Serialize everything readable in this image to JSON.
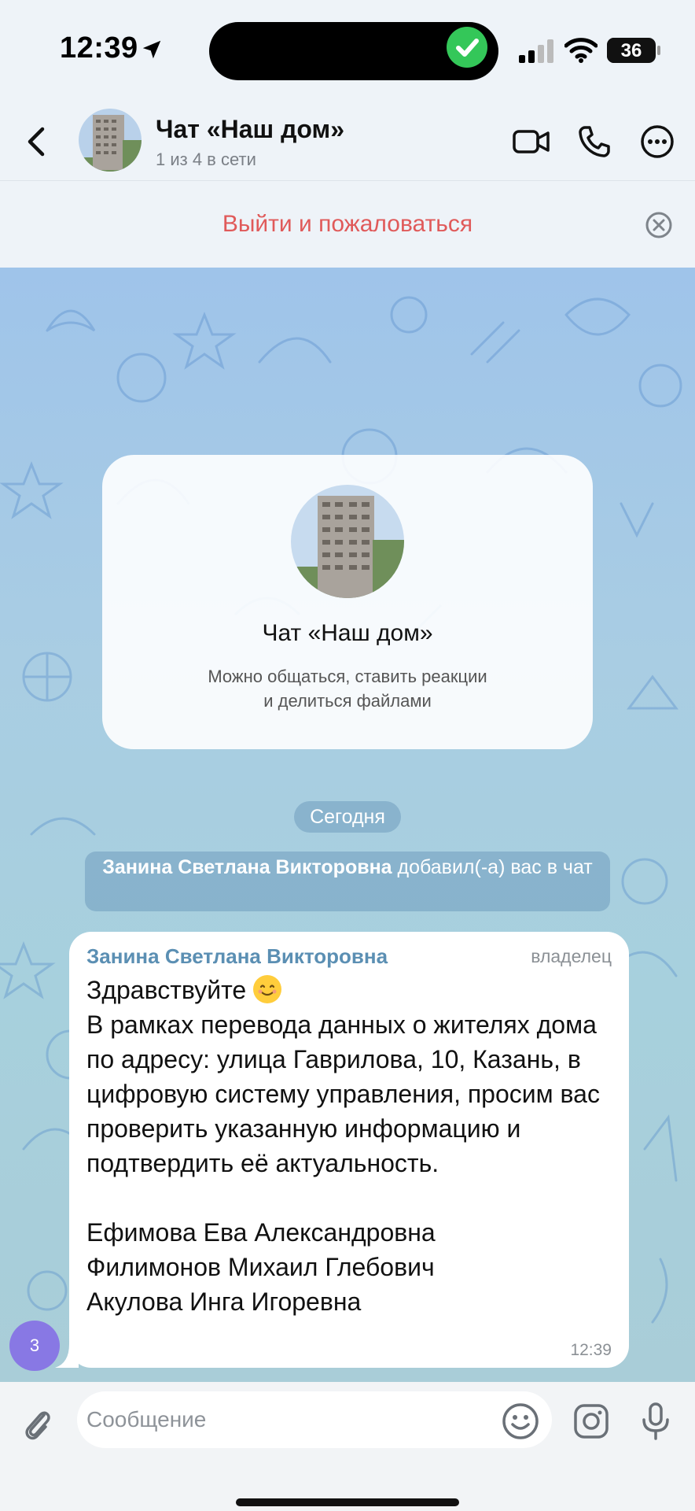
{
  "status_bar": {
    "time": "12:39",
    "battery": "36",
    "battery_level_percent": 36
  },
  "header": {
    "title": "Чат «Наш дом»",
    "subtitle": "1 из 4 в сети"
  },
  "report_bar": {
    "label": "Выйти и пожаловаться"
  },
  "info_card": {
    "title": "Чат «Наш дом»",
    "desc_line1": "Можно общаться, ставить реакции",
    "desc_line2": "и делиться файлами"
  },
  "date_pill": "Сегодня",
  "system_message": {
    "name": "Занина Светлана Викторовна",
    "text": " добавил(-а) вас в чат"
  },
  "message": {
    "sender": "Занина Светлана Викторовна",
    "role": "владелец",
    "greeting": "Здравствуйте ",
    "body": "В рамках перевода данных о жителях дома по адресу: улица Гаврилова, 10, Казань, в цифровую систему управления, просим вас проверить указанную информацию и подтвердить её актуальность.\n\nЕфимова Ева Александровна\nФилимонов Михаил Глебович\nАкулова Инга Игоревна",
    "time": "12:39"
  },
  "unread_badge": "3",
  "composer": {
    "placeholder": "Сообщение"
  },
  "colors": {
    "accent_red": "#e05a5a",
    "sender_blue": "#5b8fb3",
    "badge_purple": "#8878e4"
  },
  "icons": [
    "location-arrow-icon",
    "check-icon",
    "signal-icon",
    "wifi-icon",
    "battery-icon",
    "back-arrow-icon",
    "video-call-icon",
    "phone-icon",
    "more-icon",
    "close-circle-icon",
    "smile-emoji-icon",
    "paperclip-icon",
    "emoji-icon",
    "camera-icon",
    "microphone-icon"
  ]
}
